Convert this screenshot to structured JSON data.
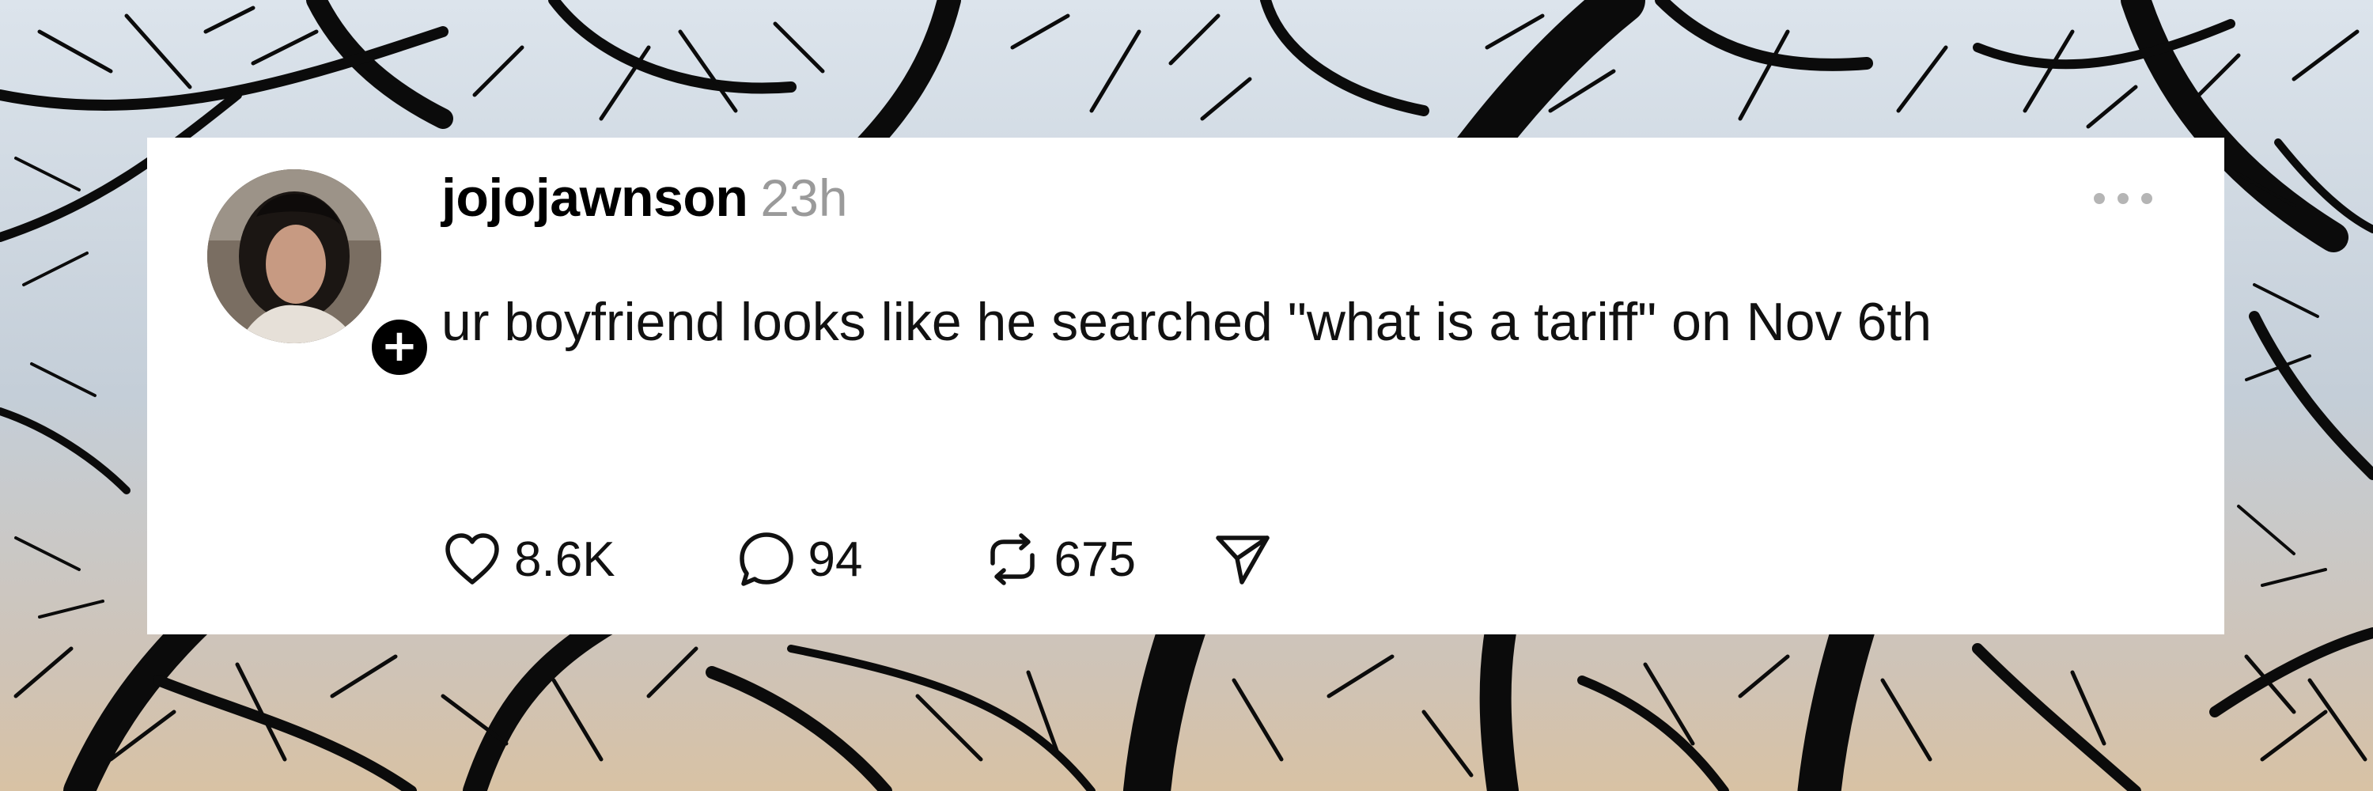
{
  "post": {
    "username": "jojojawnson",
    "timestamp": "23h",
    "text": "ur boyfriend looks like he searched \"what is a tariff\" on Nov 6th",
    "follow_badge": "+",
    "actions": {
      "likes": "8.6K",
      "replies": "94",
      "reposts": "675"
    }
  },
  "icons": {
    "follow": "plus-icon",
    "more": "more-options-icon",
    "like": "heart-icon",
    "reply": "reply-bubble-icon",
    "repost": "repost-icon",
    "share": "share-send-icon"
  },
  "colors": {
    "card_bg": "#ffffff",
    "text": "#111111",
    "timestamp": "#9a9a9a",
    "more_dots": "#b5b5b5",
    "badge": "#000000"
  }
}
